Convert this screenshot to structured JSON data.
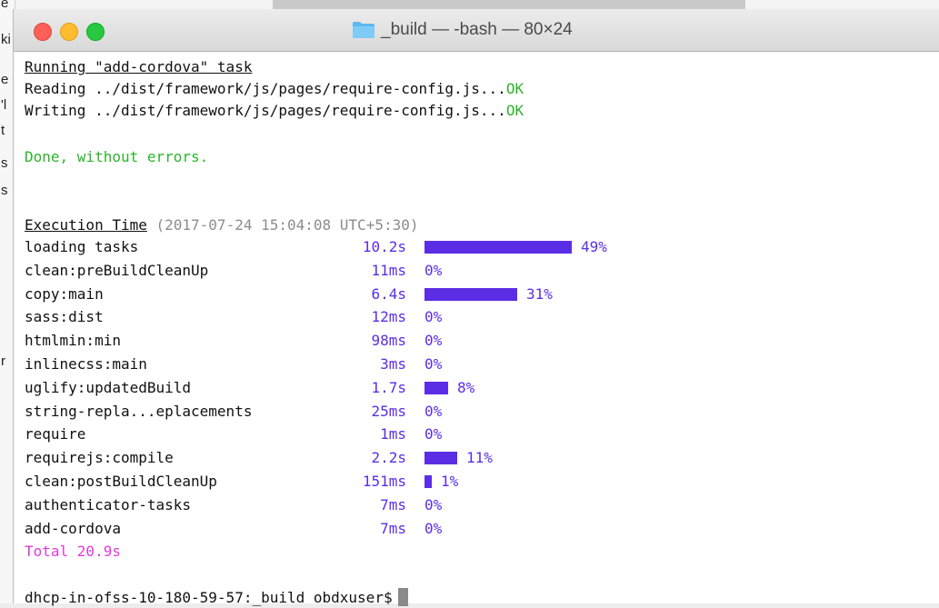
{
  "window": {
    "title": "_build — -bash — 80×24"
  },
  "background_fragments": [
    "e",
    "ki",
    "e",
    "'l",
    "t",
    "s",
    "s",
    "r"
  ],
  "terminal": {
    "task_header": "Running \"add-cordova\" task",
    "reading_text": "Reading ../dist/framework/js/pages/require-config.js...",
    "reading_status": "OK",
    "writing_text": "Writing ../dist/framework/js/pages/require-config.js...",
    "writing_status": "OK",
    "done_message": "Done, without errors.",
    "exec_label": "Execution Time",
    "exec_timestamp": "(2017-07-24 15:04:08 UTC+5:30)",
    "timings": [
      {
        "name": "loading tasks",
        "time": "10.2s",
        "percent": 49,
        "pct_label": "49%"
      },
      {
        "name": "clean:preBuildCleanUp",
        "time": "11ms",
        "percent": 0,
        "pct_label": "0%"
      },
      {
        "name": "copy:main",
        "time": "6.4s",
        "percent": 31,
        "pct_label": "31%"
      },
      {
        "name": "sass:dist",
        "time": "12ms",
        "percent": 0,
        "pct_label": "0%"
      },
      {
        "name": "htmlmin:min",
        "time": "98ms",
        "percent": 0,
        "pct_label": "0%"
      },
      {
        "name": "inlinecss:main",
        "time": "3ms",
        "percent": 0,
        "pct_label": "0%"
      },
      {
        "name": "uglify:updatedBuild",
        "time": "1.7s",
        "percent": 8,
        "pct_label": "8%"
      },
      {
        "name": "string-repla...eplacements",
        "time": "25ms",
        "percent": 0,
        "pct_label": "0%"
      },
      {
        "name": "require",
        "time": "1ms",
        "percent": 0,
        "pct_label": "0%"
      },
      {
        "name": "requirejs:compile",
        "time": "2.2s",
        "percent": 11,
        "pct_label": "11%"
      },
      {
        "name": "clean:postBuildCleanUp",
        "time": "151ms",
        "percent": 1,
        "pct_label": "1%"
      },
      {
        "name": "authenticator-tasks",
        "time": "7ms",
        "percent": 0,
        "pct_label": "0%"
      },
      {
        "name": "add-cordova",
        "time": "7ms",
        "percent": 0,
        "pct_label": "0%"
      }
    ],
    "total": "Total 20.9s",
    "prompt": "dhcp-in-ofss-10-180-59-57:_build obdxuser$"
  },
  "colors": {
    "ok": "#2bb52b",
    "timing": "#5b2ee5",
    "total": "#e03ad8",
    "muted": "#8c8c8c"
  },
  "icons": {
    "title": "folder-icon",
    "cursor": "block-cursor"
  }
}
